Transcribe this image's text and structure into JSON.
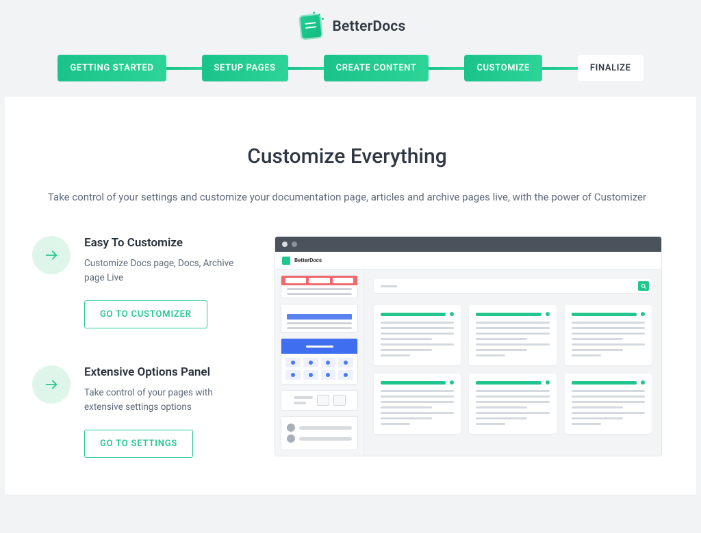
{
  "brand": {
    "name": "BetterDocs"
  },
  "steps": [
    {
      "label": "GETTING STARTED",
      "state": "done"
    },
    {
      "label": "SETUP PAGES",
      "state": "done"
    },
    {
      "label": "CREATE CONTENT",
      "state": "done"
    },
    {
      "label": "CUSTOMIZE",
      "state": "active"
    },
    {
      "label": "FINALIZE",
      "state": "pending"
    }
  ],
  "hero": {
    "title": "Customize Everything",
    "subtitle": "Take control of your settings and customize your documentation page, articles and archive pages live, with the power of Customizer"
  },
  "features": [
    {
      "title": "Easy To Customize",
      "desc": "Customize Docs page, Docs, Archive page Live",
      "cta": "GO TO CUSTOMIZER"
    },
    {
      "title": "Extensive Options Panel",
      "desc": "Take control of your pages with extensive settings options",
      "cta": "GO TO SETTINGS"
    }
  ],
  "preview": {
    "brand_mini": "BetterDocs"
  }
}
